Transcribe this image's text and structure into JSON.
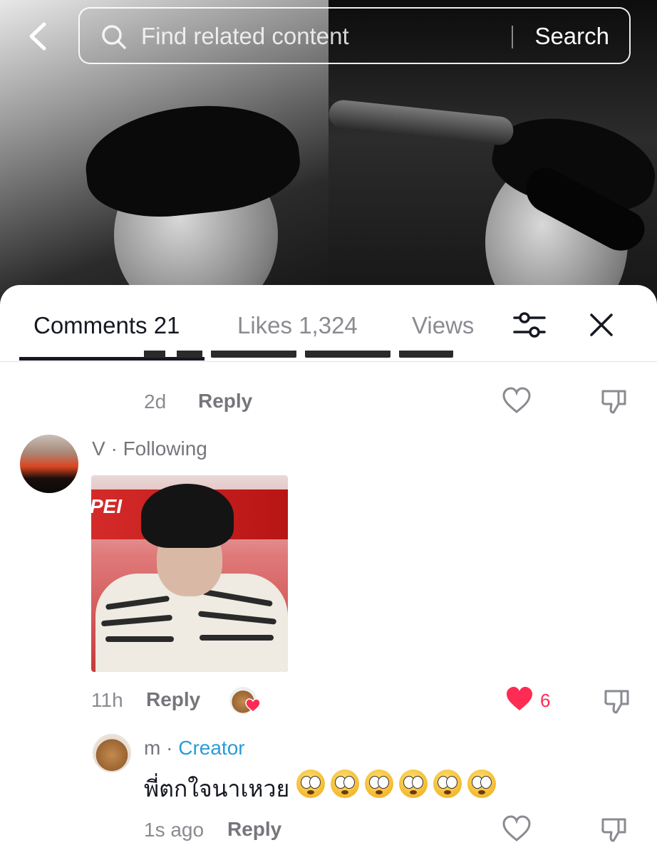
{
  "search": {
    "placeholder": "Find related content",
    "button_label": "Search"
  },
  "tabs": [
    {
      "label": "Comments 21",
      "active": true
    },
    {
      "label": "Likes 1,324",
      "active": false
    },
    {
      "label": "Views",
      "active": false
    }
  ],
  "icons": {
    "back": "chevron-left-icon",
    "search": "search-icon",
    "filter": "sliders-icon",
    "close": "close-icon",
    "like": "heart-icon",
    "dislike": "thumbs-down-icon"
  },
  "colors": {
    "accent_red": "#fe2c55",
    "creator_blue": "#2b9bd6",
    "text_primary": "#161823",
    "text_secondary": "#8a8b91"
  },
  "comments": [
    {
      "time": "2d",
      "reply_label": "Reply"
    },
    {
      "username": "V",
      "separator": " · ",
      "relation": "Following",
      "has_gif": true,
      "gif_banner_text": "PEI",
      "time": "11h",
      "reply_label": "Reply",
      "liked_by_creator": true,
      "like_count": "6",
      "liked": true
    },
    {
      "username": "m",
      "separator": " · ",
      "relation": "Creator",
      "text": "พี่ตกใจนาเหวย",
      "emoji": [
        "flushed-face",
        "flushed-face",
        "flushed-face",
        "flushed-face",
        "flushed-face",
        "flushed-face"
      ],
      "time": "1s ago",
      "reply_label": "Reply"
    }
  ]
}
